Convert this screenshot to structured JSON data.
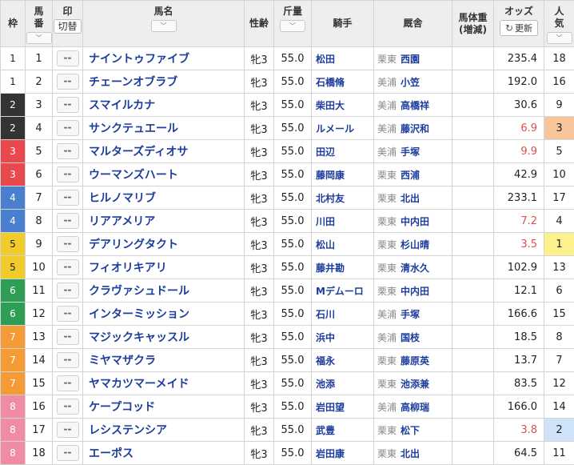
{
  "headers": {
    "waku": "枠",
    "umaban_line1": "馬",
    "umaban_line2": "番",
    "mark": "印",
    "mark_toggle": "切替",
    "horse": "馬名",
    "sexage": "性齢",
    "weight": "斤量",
    "jockey": "騎手",
    "stable": "厩舎",
    "body_weight_line1": "馬体重",
    "body_weight_line2": "(増減)",
    "odds": "オッズ",
    "refresh": "更新",
    "popularity_line1": "人",
    "popularity_line2": "気",
    "sort_glyph": "﹀"
  },
  "mark_placeholder": "--",
  "colors": {
    "waku": {
      "1": "#ffffff",
      "2": "#333333",
      "3": "#e9494d",
      "4": "#4a7fd0",
      "5": "#f0cb2a",
      "6": "#2e9e54",
      "7": "#f59b36",
      "8": "#f08ba3"
    },
    "popularity_highlight": {
      "1": "#fdf18c",
      "2": "#cfe3f8",
      "3": "#f7c69a"
    },
    "hot_odds": "#d9534f",
    "link": "#1d3d9c"
  },
  "entries": [
    {
      "waku": "1",
      "umaban": "1",
      "horse": "ナイントゥファイブ",
      "sexage": "牝3",
      "weight": "55.0",
      "jockey": "松田",
      "area": "栗東",
      "trainer": "西園",
      "odds": "235.4",
      "popularity": "18"
    },
    {
      "waku": "1",
      "umaban": "2",
      "horse": "チェーンオブラブ",
      "sexage": "牝3",
      "weight": "55.0",
      "jockey": "石橋脩",
      "area": "美浦",
      "trainer": "小笠",
      "odds": "192.0",
      "popularity": "16"
    },
    {
      "waku": "2",
      "umaban": "3",
      "horse": "スマイルカナ",
      "sexage": "牝3",
      "weight": "55.0",
      "jockey": "柴田大",
      "area": "美浦",
      "trainer": "高橋祥",
      "odds": "30.6",
      "popularity": "9"
    },
    {
      "waku": "2",
      "umaban": "4",
      "horse": "サンクテュエール",
      "sexage": "牝3",
      "weight": "55.0",
      "jockey": "ルメール",
      "area": "美浦",
      "trainer": "藤沢和",
      "odds": "6.9",
      "popularity": "3"
    },
    {
      "waku": "3",
      "umaban": "5",
      "horse": "マルターズディオサ",
      "sexage": "牝3",
      "weight": "55.0",
      "jockey": "田辺",
      "area": "美浦",
      "trainer": "手塚",
      "odds": "9.9",
      "popularity": "5"
    },
    {
      "waku": "3",
      "umaban": "6",
      "horse": "ウーマンズハート",
      "sexage": "牝3",
      "weight": "55.0",
      "jockey": "藤岡康",
      "area": "栗東",
      "trainer": "西浦",
      "odds": "42.9",
      "popularity": "10"
    },
    {
      "waku": "4",
      "umaban": "7",
      "horse": "ヒルノマリブ",
      "sexage": "牝3",
      "weight": "55.0",
      "jockey": "北村友",
      "area": "栗東",
      "trainer": "北出",
      "odds": "233.1",
      "popularity": "17"
    },
    {
      "waku": "4",
      "umaban": "8",
      "horse": "リアアメリア",
      "sexage": "牝3",
      "weight": "55.0",
      "jockey": "川田",
      "area": "栗東",
      "trainer": "中内田",
      "odds": "7.2",
      "popularity": "4"
    },
    {
      "waku": "5",
      "umaban": "9",
      "horse": "デアリングタクト",
      "sexage": "牝3",
      "weight": "55.0",
      "jockey": "松山",
      "area": "栗東",
      "trainer": "杉山晴",
      "odds": "3.5",
      "popularity": "1"
    },
    {
      "waku": "5",
      "umaban": "10",
      "horse": "フィオリキアリ",
      "sexage": "牝3",
      "weight": "55.0",
      "jockey": "藤井勘",
      "area": "栗東",
      "trainer": "清水久",
      "odds": "102.9",
      "popularity": "13"
    },
    {
      "waku": "6",
      "umaban": "11",
      "horse": "クラヴァシュドール",
      "sexage": "牝3",
      "weight": "55.0",
      "jockey": "Mデムーロ",
      "area": "栗東",
      "trainer": "中内田",
      "odds": "12.1",
      "popularity": "6"
    },
    {
      "waku": "6",
      "umaban": "12",
      "horse": "インターミッション",
      "sexage": "牝3",
      "weight": "55.0",
      "jockey": "石川",
      "area": "美浦",
      "trainer": "手塚",
      "odds": "166.6",
      "popularity": "15"
    },
    {
      "waku": "7",
      "umaban": "13",
      "horse": "マジックキャッスル",
      "sexage": "牝3",
      "weight": "55.0",
      "jockey": "浜中",
      "area": "美浦",
      "trainer": "国枝",
      "odds": "18.5",
      "popularity": "8"
    },
    {
      "waku": "7",
      "umaban": "14",
      "horse": "ミヤマザクラ",
      "sexage": "牝3",
      "weight": "55.0",
      "jockey": "福永",
      "area": "栗東",
      "trainer": "藤原英",
      "odds": "13.7",
      "popularity": "7"
    },
    {
      "waku": "7",
      "umaban": "15",
      "horse": "ヤマカツマーメイド",
      "sexage": "牝3",
      "weight": "55.0",
      "jockey": "池添",
      "area": "栗東",
      "trainer": "池添兼",
      "odds": "83.5",
      "popularity": "12"
    },
    {
      "waku": "8",
      "umaban": "16",
      "horse": "ケープコッド",
      "sexage": "牝3",
      "weight": "55.0",
      "jockey": "岩田望",
      "area": "美浦",
      "trainer": "高柳瑞",
      "odds": "166.0",
      "popularity": "14"
    },
    {
      "waku": "8",
      "umaban": "17",
      "horse": "レシステンシア",
      "sexage": "牝3",
      "weight": "55.0",
      "jockey": "武豊",
      "area": "栗東",
      "trainer": "松下",
      "odds": "3.8",
      "popularity": "2"
    },
    {
      "waku": "8",
      "umaban": "18",
      "horse": "エーポス",
      "sexage": "牝3",
      "weight": "55.0",
      "jockey": "岩田康",
      "area": "栗東",
      "trainer": "北出",
      "odds": "64.5",
      "popularity": "11"
    }
  ]
}
